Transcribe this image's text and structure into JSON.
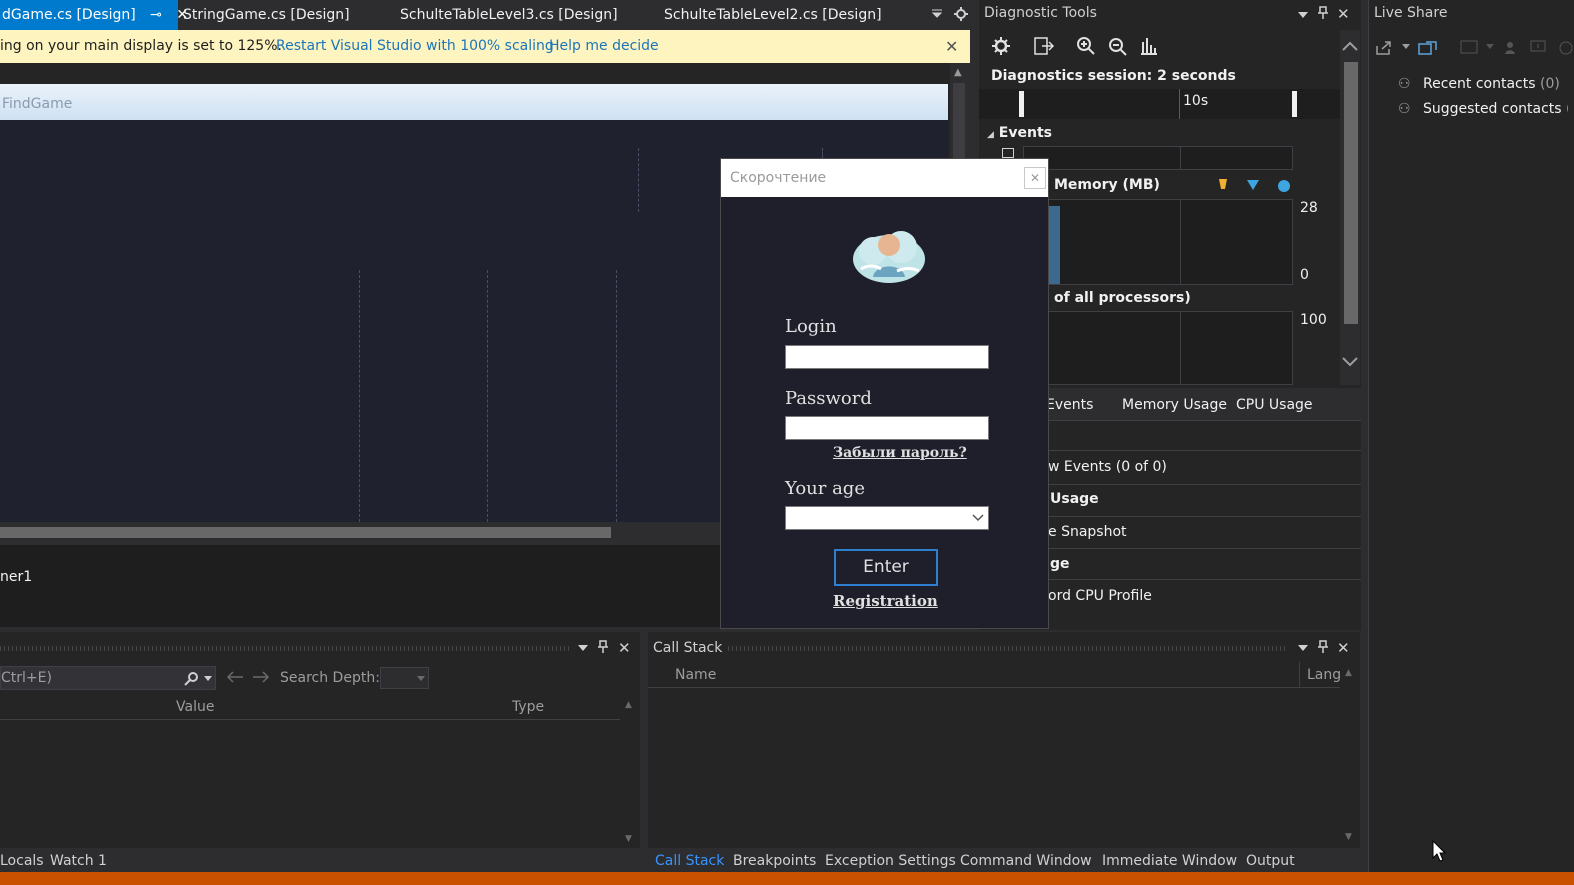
{
  "tabs": [
    {
      "label": "dGame.cs [Design]",
      "active": true
    },
    {
      "label": "StringGame.cs [Design]"
    },
    {
      "label": "SchulteTableLevel3.cs [Design]"
    },
    {
      "label": "SchulteTableLevel2.cs [Design]"
    }
  ],
  "infobar": {
    "message": "ing on your main display is set to 125%.",
    "restart_link": "Restart Visual Studio with 100% scaling",
    "help_link": "Help me decide"
  },
  "designer": {
    "form_title": "FindGame",
    "tray_component": "ner1"
  },
  "dialog": {
    "title": "Скорочтение",
    "login_label": "Login",
    "password_label": "Password",
    "forgot_link": "Забыли пароль?",
    "age_label": "Your age",
    "enter_button": "Enter",
    "registration_link": "Registration"
  },
  "diagnostics": {
    "title": "Diagnostic Tools",
    "session": "Diagnostics session: 2 seconds",
    "timeline_tick": "10s",
    "events_header": "Events",
    "memory_label": "Memory (MB)",
    "memory_max": "28",
    "memory_min": "0",
    "cpu_label": "of all processors)",
    "cpu_max": "100",
    "tabs": [
      "Events",
      "Memory Usage",
      "CPU Usage"
    ],
    "rows": [
      "w Events (0 of 0)",
      "Usage",
      "e Snapshot",
      "ge",
      "ord CPU Profile"
    ]
  },
  "liveshare": {
    "title": "Live Share",
    "recent": "Recent contacts",
    "recent_count": "(0)",
    "suggested": "Suggested contacts",
    "suggested_count": "("
  },
  "locals": {
    "search_placeholder": "Ctrl+E)",
    "search_depth_label": "Search Depth:",
    "columns": [
      "Value",
      "Type"
    ]
  },
  "callstack": {
    "title": "Call Stack",
    "columns": [
      "Name",
      "Lang"
    ]
  },
  "bottom_tabs_left": [
    "Locals",
    "Watch 1"
  ],
  "bottom_tabs_right": [
    "Call Stack",
    "Breakpoints",
    "Exception Settings",
    "Command Window",
    "Immediate Window",
    "Output"
  ],
  "colors": {
    "accent": "#007acc",
    "infobar_bg": "#fdf4bf",
    "status_bar": "#ca5100",
    "dialog_bg": "#1e1f2b"
  }
}
